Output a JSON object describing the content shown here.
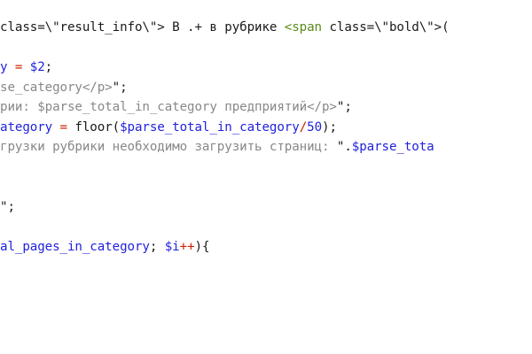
{
  "colors": {
    "default": "#1a1a1a",
    "string": "#1a1a1a",
    "variable": "#2222dd",
    "tag": "#5a8a1a",
    "operator": "#cc2200",
    "number": "#2222dd",
    "comment": "#888888"
  },
  "code": {
    "lines": [
      {
        "tokens": [
          {
            "text": "class=\\\"result_info\\\"> В .+ в рубрике ",
            "kind": "string"
          },
          {
            "text": "<span",
            "kind": "tag"
          },
          {
            "text": " class=\\\"bold\\\">",
            "kind": "string"
          },
          {
            "text": "(",
            "kind": "string"
          }
        ]
      },
      {
        "tokens": []
      },
      {
        "tokens": [
          {
            "text": "y",
            "kind": "variable"
          },
          {
            "text": " = ",
            "kind": "operator"
          },
          {
            "text": "$2",
            "kind": "variable"
          },
          {
            "text": ";",
            "kind": "default"
          }
        ]
      },
      {
        "tokens": [
          {
            "text": "se_category</p>",
            "kind": "comment"
          },
          {
            "text": "\";",
            "kind": "default"
          }
        ]
      },
      {
        "tokens": [
          {
            "text": "рии: $parse_total_in_category предприятий</p>",
            "kind": "comment"
          },
          {
            "text": "\";",
            "kind": "default"
          }
        ]
      },
      {
        "tokens": [
          {
            "text": "ategory",
            "kind": "variable"
          },
          {
            "text": " = ",
            "kind": "operator"
          },
          {
            "text": "floor(",
            "kind": "default"
          },
          {
            "text": "$parse_total_in_category",
            "kind": "variable"
          },
          {
            "text": "/",
            "kind": "operator"
          },
          {
            "text": "50",
            "kind": "number"
          },
          {
            "text": ");",
            "kind": "default"
          }
        ]
      },
      {
        "tokens": [
          {
            "text": "грузки рубрики необходимо загрузить страниц: ",
            "kind": "comment"
          },
          {
            "text": "\".",
            "kind": "default"
          },
          {
            "text": "$parse_tota",
            "kind": "variable"
          }
        ]
      },
      {
        "tokens": []
      },
      {
        "tokens": []
      },
      {
        "tokens": [
          {
            "text": "\";",
            "kind": "default"
          }
        ]
      },
      {
        "tokens": []
      },
      {
        "tokens": [
          {
            "text": "al_pages_in_category",
            "kind": "variable"
          },
          {
            "text": "; ",
            "kind": "default"
          },
          {
            "text": "$i",
            "kind": "variable"
          },
          {
            "text": "++",
            "kind": "operator"
          },
          {
            "text": "){",
            "kind": "default"
          }
        ]
      }
    ]
  }
}
